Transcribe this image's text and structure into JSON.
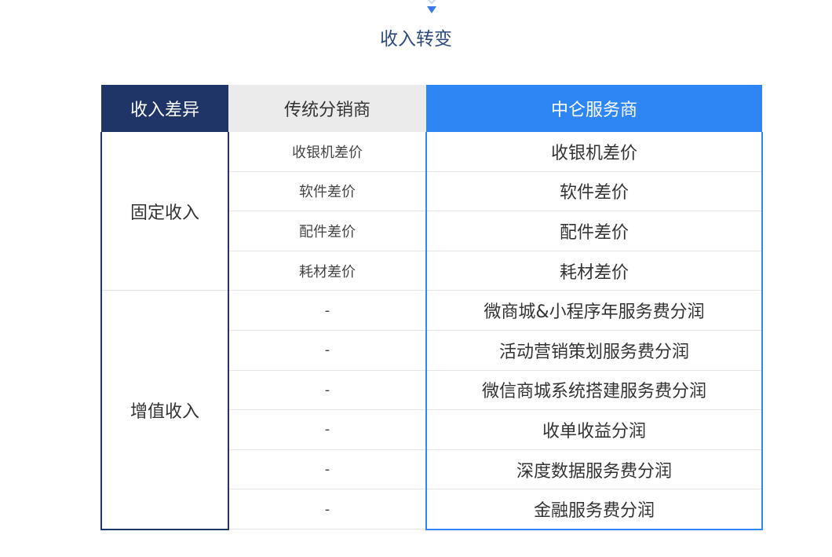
{
  "title": "收入转变",
  "headers": {
    "diff": "收入差异",
    "traditional": "传统分销商",
    "zhonglun": "中仑服务商"
  },
  "groups": [
    {
      "category": "固定收入",
      "rows": [
        {
          "traditional": "收银机差价",
          "zhonglun": "收银机差价"
        },
        {
          "traditional": "软件差价",
          "zhonglun": "软件差价"
        },
        {
          "traditional": "配件差价",
          "zhonglun": "配件差价"
        },
        {
          "traditional": "耗材差价",
          "zhonglun": "耗材差价"
        }
      ]
    },
    {
      "category": "增值收入",
      "rows": [
        {
          "traditional": "-",
          "zhonglun": "微商城&小程序年服务费分润"
        },
        {
          "traditional": "-",
          "zhonglun": "活动营销策划服务费分润"
        },
        {
          "traditional": "-",
          "zhonglun": "微信商城系统搭建服务费分润"
        },
        {
          "traditional": "-",
          "zhonglun": "收单收益分润"
        },
        {
          "traditional": "-",
          "zhonglun": "深度数据服务费分润"
        },
        {
          "traditional": "-",
          "zhonglun": "金融服务费分润"
        }
      ]
    }
  ],
  "colors": {
    "navy": "#1f3467",
    "blue": "#2e86f5",
    "gray_header": "#ebebeb",
    "title_text": "#2d4a7c"
  },
  "icons": {
    "top_arrow": "double-chevron-down-icon"
  }
}
